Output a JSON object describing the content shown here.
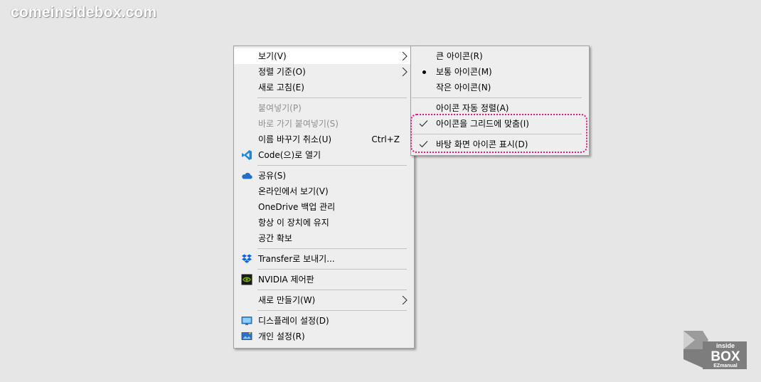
{
  "watermark": "comeinsidebox.com",
  "main_menu": {
    "items": [
      {
        "label": "보기(V)",
        "has_submenu": true,
        "highlighted": true
      },
      {
        "label": "정렬 기준(O)",
        "has_submenu": true
      },
      {
        "label": "새로 고침(E)"
      },
      {
        "label": "붙여넣기(P)",
        "disabled": true
      },
      {
        "label": "바로 가기 붙여넣기(S)",
        "disabled": true
      },
      {
        "label": "이름 바꾸기 취소(U)",
        "shortcut": "Ctrl+Z"
      },
      {
        "label": "Code(으)로 열기",
        "icon": "vscode-icon"
      },
      {
        "label": "공유(S)",
        "icon": "onedrive-cloud-icon"
      },
      {
        "label": "온라인에서 보기(V)"
      },
      {
        "label": "OneDrive 백업 관리"
      },
      {
        "label": "항상 이 장치에 유지"
      },
      {
        "label": "공간 확보"
      },
      {
        "label": "Transfer로 보내기...",
        "icon": "dropbox-icon"
      },
      {
        "label": "NVIDIA 제어판",
        "icon": "nvidia-icon"
      },
      {
        "label": "새로 만들기(W)",
        "has_submenu": true
      },
      {
        "label": "디스플레이 설정(D)",
        "icon": "display-settings-icon"
      },
      {
        "label": "개인 설정(R)",
        "icon": "personalize-icon"
      }
    ]
  },
  "sub_menu": {
    "items": [
      {
        "label": "큰 아이콘(R)"
      },
      {
        "label": "보통 아이콘(M)",
        "selected": true
      },
      {
        "label": "작은 아이콘(N)"
      },
      {
        "label": "아이콘 자동 정렬(A)"
      },
      {
        "label": "아이콘을 그리드에 맞춤(I)",
        "checked": true
      },
      {
        "label": "바탕 화면 아이콘 표시(D)",
        "checked": true
      }
    ]
  },
  "logo": {
    "line1": "inside",
    "line2": "BOX",
    "line3": "EZmanual"
  },
  "colors": {
    "highlight_border": "#e3167f",
    "menu_bg": "#eeeeee",
    "desktop_bg": "#e6e6e6"
  }
}
